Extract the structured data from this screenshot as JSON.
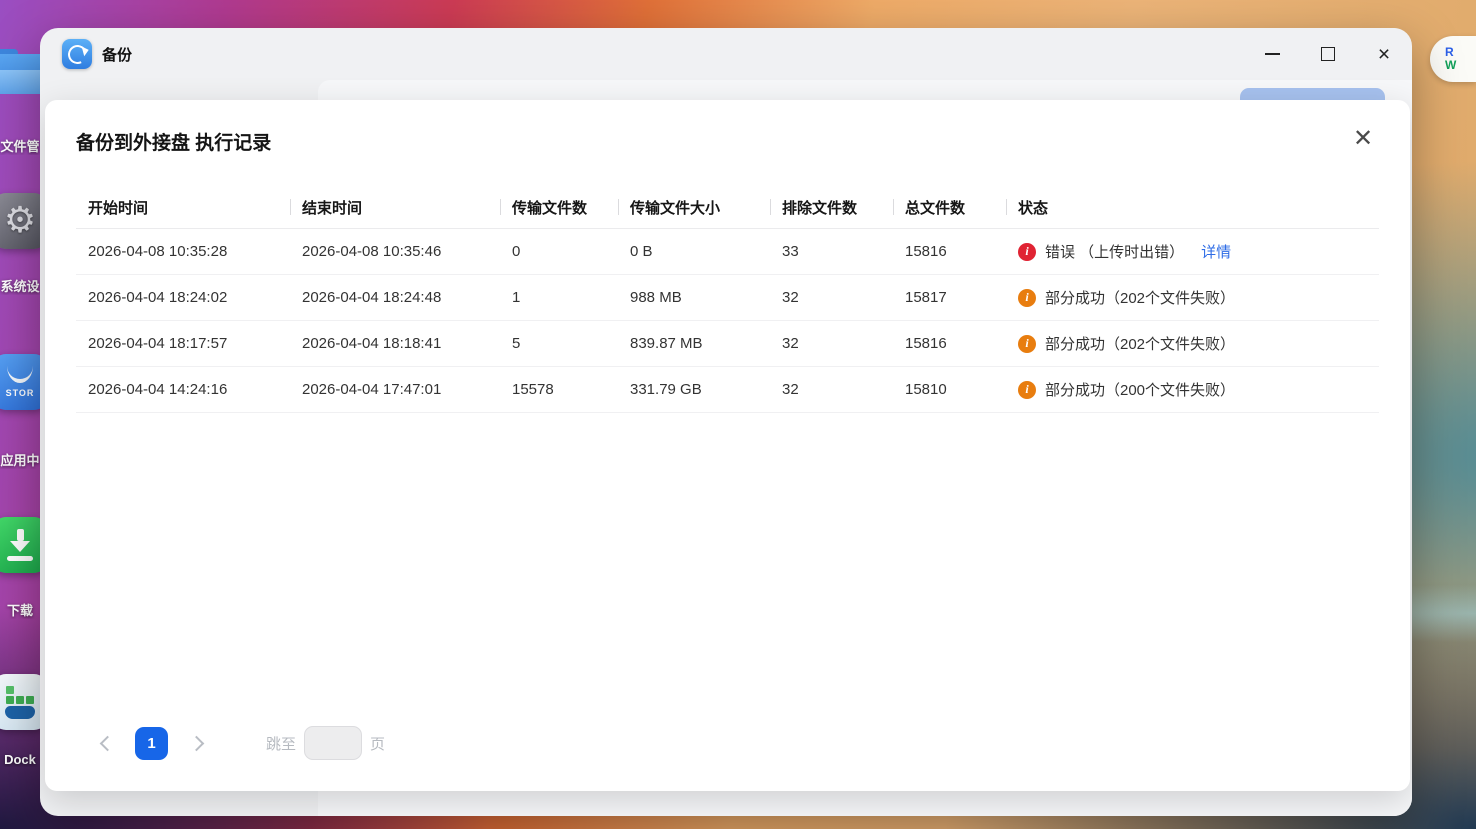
{
  "desktop": {
    "icons": [
      {
        "label": "文件管"
      },
      {
        "label": "系统设"
      },
      {
        "label": "应用中",
        "icon_text": "STOR"
      },
      {
        "label": "下载"
      },
      {
        "label": "Dock"
      }
    ],
    "edge_badge": {
      "r": "R",
      "w": "W"
    }
  },
  "window": {
    "title": "备份"
  },
  "dialog": {
    "title": "备份到外接盘 执行记录",
    "table": {
      "headers": [
        "开始时间",
        "结束时间",
        "传输文件数",
        "传输文件大小",
        "排除文件数",
        "总文件数",
        "状态"
      ],
      "rows": [
        {
          "start": "2026-04-08 10:35:28",
          "end": "2026-04-08 10:35:46",
          "transferred": "0",
          "size": "0 B",
          "excluded": "33",
          "total": "15816",
          "status": {
            "type": "error",
            "icon": "i",
            "text": "错误 （上传时出错）",
            "link": "详情"
          }
        },
        {
          "start": "2026-04-04 18:24:02",
          "end": "2026-04-04 18:24:48",
          "transferred": "1",
          "size": "988 MB",
          "excluded": "32",
          "total": "15817",
          "status": {
            "type": "warning",
            "icon": "i",
            "text": "部分成功（202个文件失败）"
          }
        },
        {
          "start": "2026-04-04 18:17:57",
          "end": "2026-04-04 18:18:41",
          "transferred": "5",
          "size": "839.87 MB",
          "excluded": "32",
          "total": "15816",
          "status": {
            "type": "warning",
            "icon": "i",
            "text": "部分成功（202个文件失败）"
          }
        },
        {
          "start": "2026-04-04 14:24:16",
          "end": "2026-04-04 17:47:01",
          "transferred": "15578",
          "size": "331.79 GB",
          "excluded": "32",
          "total": "15810",
          "status": {
            "type": "warning",
            "icon": "i",
            "text": "部分成功（200个文件失败）"
          }
        }
      ]
    },
    "pagination": {
      "current_page": "1",
      "jump_label": "跳至",
      "page_suffix": "页",
      "jump_value": ""
    },
    "colors": {
      "error": "#e02333",
      "warning": "#e87d0f",
      "link": "#2e6ce6",
      "active_page": "#1766e8"
    }
  }
}
